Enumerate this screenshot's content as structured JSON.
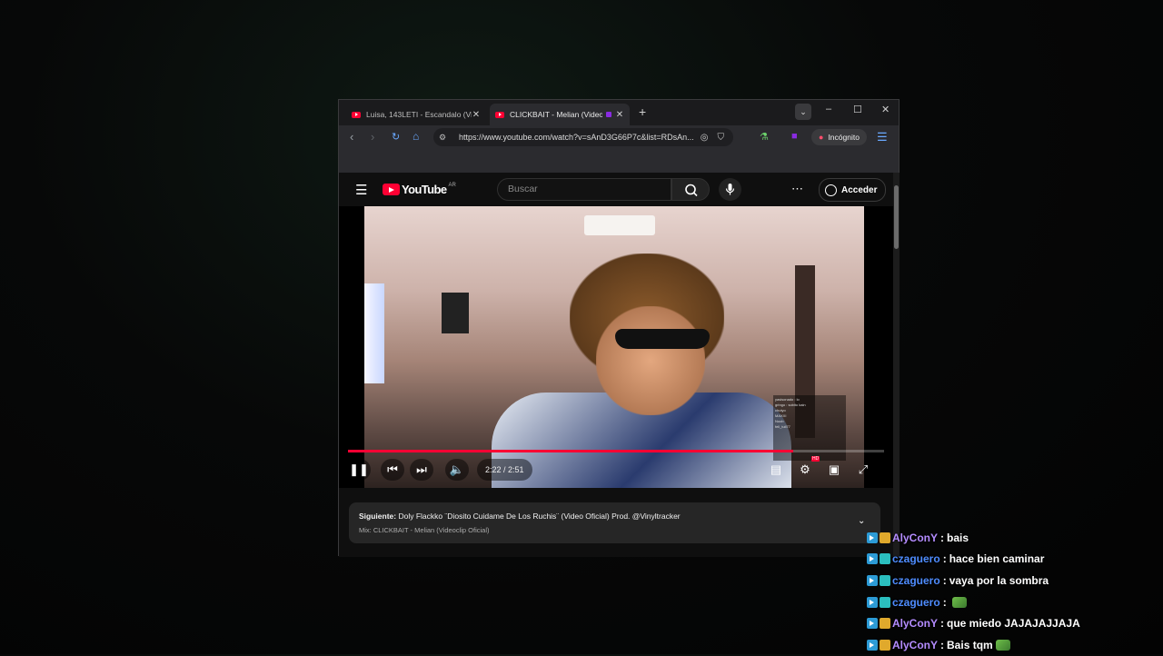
{
  "browser": {
    "tabs": [
      {
        "title": "Luisa, 143LETI - Escandalo (Vide",
        "active": false
      },
      {
        "title": "CLICKBAIT - Melian (Videoc",
        "active": true
      }
    ],
    "new_tab_symbol": "+",
    "window_controls": {
      "minimize": "–",
      "maximize": "☐",
      "close": "✕",
      "dropdown": "⌄"
    },
    "nav": {
      "back": "‹",
      "forward": "›",
      "reload": "↻",
      "home": "⌂"
    },
    "url": "https://www.youtube.com/watch?v=sAnD3G66P7c&list=RDsAn...",
    "incognito_label": "Incógnito",
    "icons": [
      "eye-off-icon",
      "bookmark-icon",
      "flask-icon",
      "extension-icon",
      "menu-icon"
    ]
  },
  "youtube": {
    "logo_text": "YouTube",
    "region": "AR",
    "search_placeholder": "Buscar",
    "signin_label": "Acceder",
    "player": {
      "time": "2:22 / 2:51",
      "progress_fraction": 0.83,
      "hd_badge": "HD",
      "overlay_chat_lines": [
        "yasisonado : lo",
        "gringo : sobito kain",
        "chutyo",
        "MAXXI",
        "Noob",
        "feli_tuli77"
      ]
    },
    "up_next": {
      "prefix": "Siguiente:",
      "title": "Doly Flackko ¨Diosito Cuidame De Los Ruchis¨ (Video Oficial) Prod. @Vinyltracker",
      "mix": "Mix: CLICKBAIT - Melian (Videoclip Oficial)"
    }
  },
  "chat": [
    {
      "user": "AlyConY",
      "color": "aly",
      "badge": "b-sub-gold",
      "text": "bais",
      "emote": false
    },
    {
      "user": "czaguero",
      "color": "cz",
      "badge": "b-sub-teal",
      "text": "hace bien caminar",
      "emote": false
    },
    {
      "user": "czaguero",
      "color": "cz",
      "badge": "b-sub-teal",
      "text": "vaya por la sombra",
      "emote": false
    },
    {
      "user": "czaguero",
      "color": "cz",
      "badge": "b-sub-teal",
      "text": "",
      "emote": true
    },
    {
      "user": "AlyConY",
      "color": "aly",
      "badge": "b-sub-gold",
      "text": "que miedo JAJAJAJJAJA",
      "emote": false
    },
    {
      "user": "AlyConY",
      "color": "aly",
      "badge": "b-sub-gold",
      "text": "Bais tqm",
      "emote": true
    }
  ],
  "chat_separator": ":"
}
